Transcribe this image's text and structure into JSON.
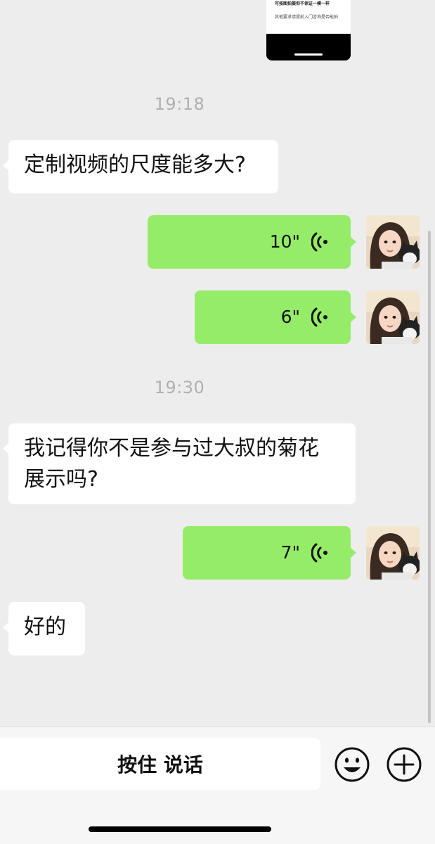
{
  "thumbnail": {
    "line1": "可按图拍摄但不保证一模一样",
    "line2": "其他要求请提前入门咨询是否能拍"
  },
  "messages": [
    {
      "type": "timestamp",
      "text": "19:18"
    },
    {
      "type": "text",
      "side": "left",
      "text": "定制视频的尺度能多大?"
    },
    {
      "type": "voice",
      "side": "right",
      "duration": "10\""
    },
    {
      "type": "voice",
      "side": "right",
      "duration": "6\""
    },
    {
      "type": "timestamp",
      "text": "19:30"
    },
    {
      "type": "text",
      "side": "left",
      "line1": "我记得你不是参与过大叔的菊花",
      "line2": "展示吗?"
    },
    {
      "type": "voice",
      "side": "right",
      "duration": "7\""
    },
    {
      "type": "text",
      "side": "left",
      "text": "好的"
    }
  ],
  "input_bar": {
    "hold_to_talk_label": "按住 说话",
    "icons": [
      "emoji-icon",
      "plus-icon"
    ]
  },
  "colors": {
    "background": "#ededed",
    "sent_bubble": "#95ec69",
    "received_bubble": "#ffffff",
    "timestamp_text": "#b0b0b0"
  }
}
